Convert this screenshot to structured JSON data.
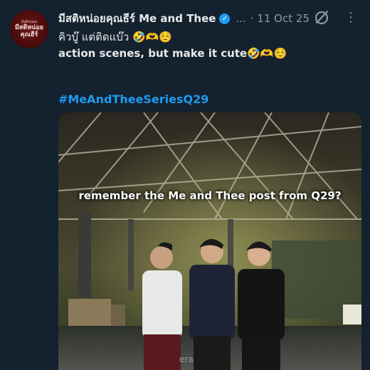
{
  "tweet": {
    "avatar_text_small": "มีสติหน่อย",
    "avatar_text_big": "มีสติหน่อย คุณธีร์",
    "display_name": "มีสติหน่อยคุณธีร์ Me and Thee",
    "verified_mark": "✓",
    "separator": "...",
    "date": "· 11 Oct 25",
    "grok_icon": "grok-icon",
    "more_icon": "⋮",
    "line1": "คิวบู๊ แต่ติดแบ๊ว 🤣🫶☺️",
    "line2": "action scenes, but make it cute🤣🫶☺️",
    "hashtag": "#MeAndTheeSeriesQ29",
    "media": {
      "caption": "remember the Me and Thee post from Q29?",
      "watermark": "era"
    }
  },
  "colors": {
    "background": "#14212e",
    "accent": "#1d9bf0",
    "text": "#e7e9ea",
    "muted": "#8b98a5"
  }
}
